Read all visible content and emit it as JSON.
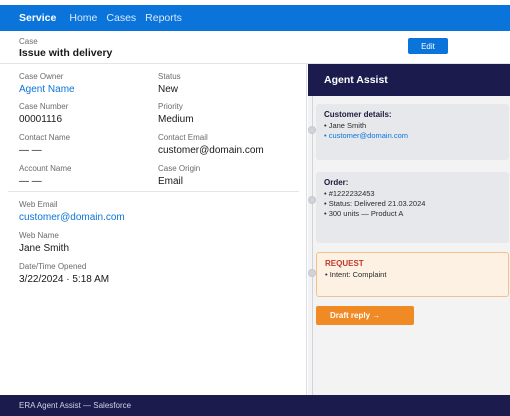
{
  "nav": {
    "brand": "Service",
    "links": [
      "Home",
      "Cases",
      "Reports"
    ]
  },
  "case": {
    "label": "Case",
    "title": "Issue with delivery",
    "edit_label": "Edit"
  },
  "details": {
    "case_owner": {
      "label": "Case Owner",
      "value": "Agent Name"
    },
    "status": {
      "label": "Status",
      "value": "New"
    },
    "case_number": {
      "label": "Case Number",
      "value": "00001116"
    },
    "priority": {
      "label": "Priority",
      "value": "Medium"
    },
    "contact_name": {
      "label": "Contact Name",
      "value": "— —"
    },
    "contact_email": {
      "label": "Contact Email",
      "value": "customer@domain.com"
    },
    "account_name": {
      "label": "Account Name",
      "value": "— —"
    },
    "case_origin": {
      "label": "Case Origin",
      "value": "Email"
    },
    "web_email": {
      "label": "Web Email",
      "value": "customer@domain.com"
    },
    "web_name": {
      "label": "Web Name",
      "value": "Jane Smith"
    },
    "opened": {
      "label": "Date/Time Opened",
      "value": "3/22/2024 · 5:18 AM"
    }
  },
  "assist": {
    "header": "Agent Assist",
    "customer": {
      "title": "Customer details:",
      "items": [
        "• Jane Smith",
        "• customer@domain.com"
      ]
    },
    "order": {
      "title": "Order:",
      "items": [
        "• #1222232453",
        "• Status: Delivered 21.03.2024",
        "• 300 units — Product A"
      ]
    },
    "request": {
      "title": "REQUEST",
      "items": [
        "• Intent: Complaint"
      ]
    },
    "draft_label": "Draft reply →"
  },
  "footer": "ERA Agent Assist — Salesforce",
  "colors": {
    "brand_blue": "#0a74da",
    "navy": "#1b1b4d",
    "orange": "#f08a24",
    "request_red": "#c0392b"
  }
}
